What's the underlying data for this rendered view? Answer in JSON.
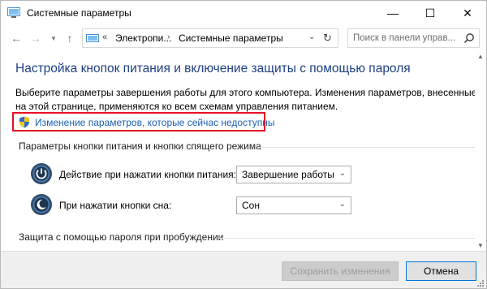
{
  "window": {
    "title": "Системные параметры",
    "controls": {
      "minimize": "—",
      "maximize": "☐",
      "close": "✕"
    }
  },
  "nav": {
    "back": "←",
    "forward": "→",
    "recent": "▼",
    "up": "↑",
    "address": {
      "separator": "«",
      "crumbs": [
        "Электропи...",
        "Системные параметры"
      ],
      "chevron": "›",
      "dropdown": "⌄",
      "refresh": "↻"
    },
    "search": {
      "placeholder": "Поиск в панели управ..."
    }
  },
  "content": {
    "title": "Настройка кнопок питания и включение защиты с помощью пароля",
    "description": "Выберите параметры завершения работы для этого компьютера. Изменения параметров, внесенные на этой странице, применяются ко всем схемам управления питанием.",
    "change_link": "Изменение параметров, которые сейчас недоступны",
    "section_power": "Параметры кнопки питания и кнопки спящего режима",
    "rows": [
      {
        "label": "Действие при нажатии кнопки питания:",
        "value": "Завершение работы"
      },
      {
        "label": "При нажатии кнопки сна:",
        "value": "Сон"
      }
    ],
    "section_password": "Защита с помощью пароля при пробуждении"
  },
  "footer": {
    "save_label": "Сохранить изменения",
    "cancel_label": "Отмена"
  },
  "colors": {
    "title_blue": "#1e3f84",
    "link_blue": "#1a5fb4",
    "highlight_red": "#e81123",
    "accent": "#0078d7"
  }
}
